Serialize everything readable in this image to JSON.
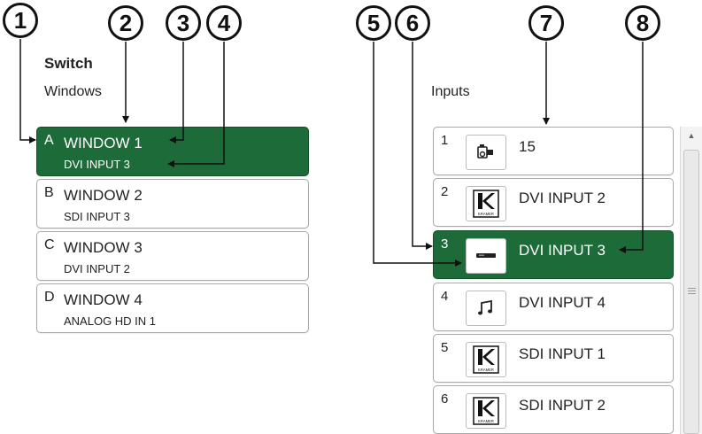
{
  "callouts": [
    "1",
    "2",
    "3",
    "4",
    "5",
    "6",
    "7",
    "8"
  ],
  "left_panel": {
    "title": "Switch",
    "section_label": "Windows",
    "windows": [
      {
        "letter": "A",
        "title": "WINDOW 1",
        "input": "DVI INPUT 3",
        "selected": true
      },
      {
        "letter": "B",
        "title": "WINDOW 2",
        "input": "SDI INPUT 3",
        "selected": false
      },
      {
        "letter": "C",
        "title": "WINDOW 3",
        "input": "DVI INPUT 2",
        "selected": false
      },
      {
        "letter": "D",
        "title": "WINDOW 4",
        "input": "ANALOG HD IN 1",
        "selected": false
      }
    ]
  },
  "right_panel": {
    "section_label": "Inputs",
    "inputs": [
      {
        "number": "1",
        "label": "15",
        "icon": "camcorder-icon",
        "selected": false
      },
      {
        "number": "2",
        "label": "DVI INPUT 2",
        "icon": "kramer-logo-icon",
        "logo_text": "KRAMER",
        "selected": false
      },
      {
        "number": "3",
        "label": "DVI INPUT 3",
        "icon": "set-top-box-icon",
        "selected": true
      },
      {
        "number": "4",
        "label": "DVI INPUT 4",
        "icon": "music-note-icon",
        "selected": false
      },
      {
        "number": "5",
        "label": "SDI INPUT 1",
        "icon": "kramer-logo-icon",
        "logo_text": "KRAMER",
        "selected": false
      },
      {
        "number": "6",
        "label": "SDI INPUT 2",
        "icon": "kramer-logo-icon",
        "logo_text": "KRAMER",
        "selected": false
      }
    ]
  },
  "colors": {
    "selected_bg": "#1e6b3a",
    "card_border": "#a9a9a9",
    "callout_stroke": "#111111"
  }
}
